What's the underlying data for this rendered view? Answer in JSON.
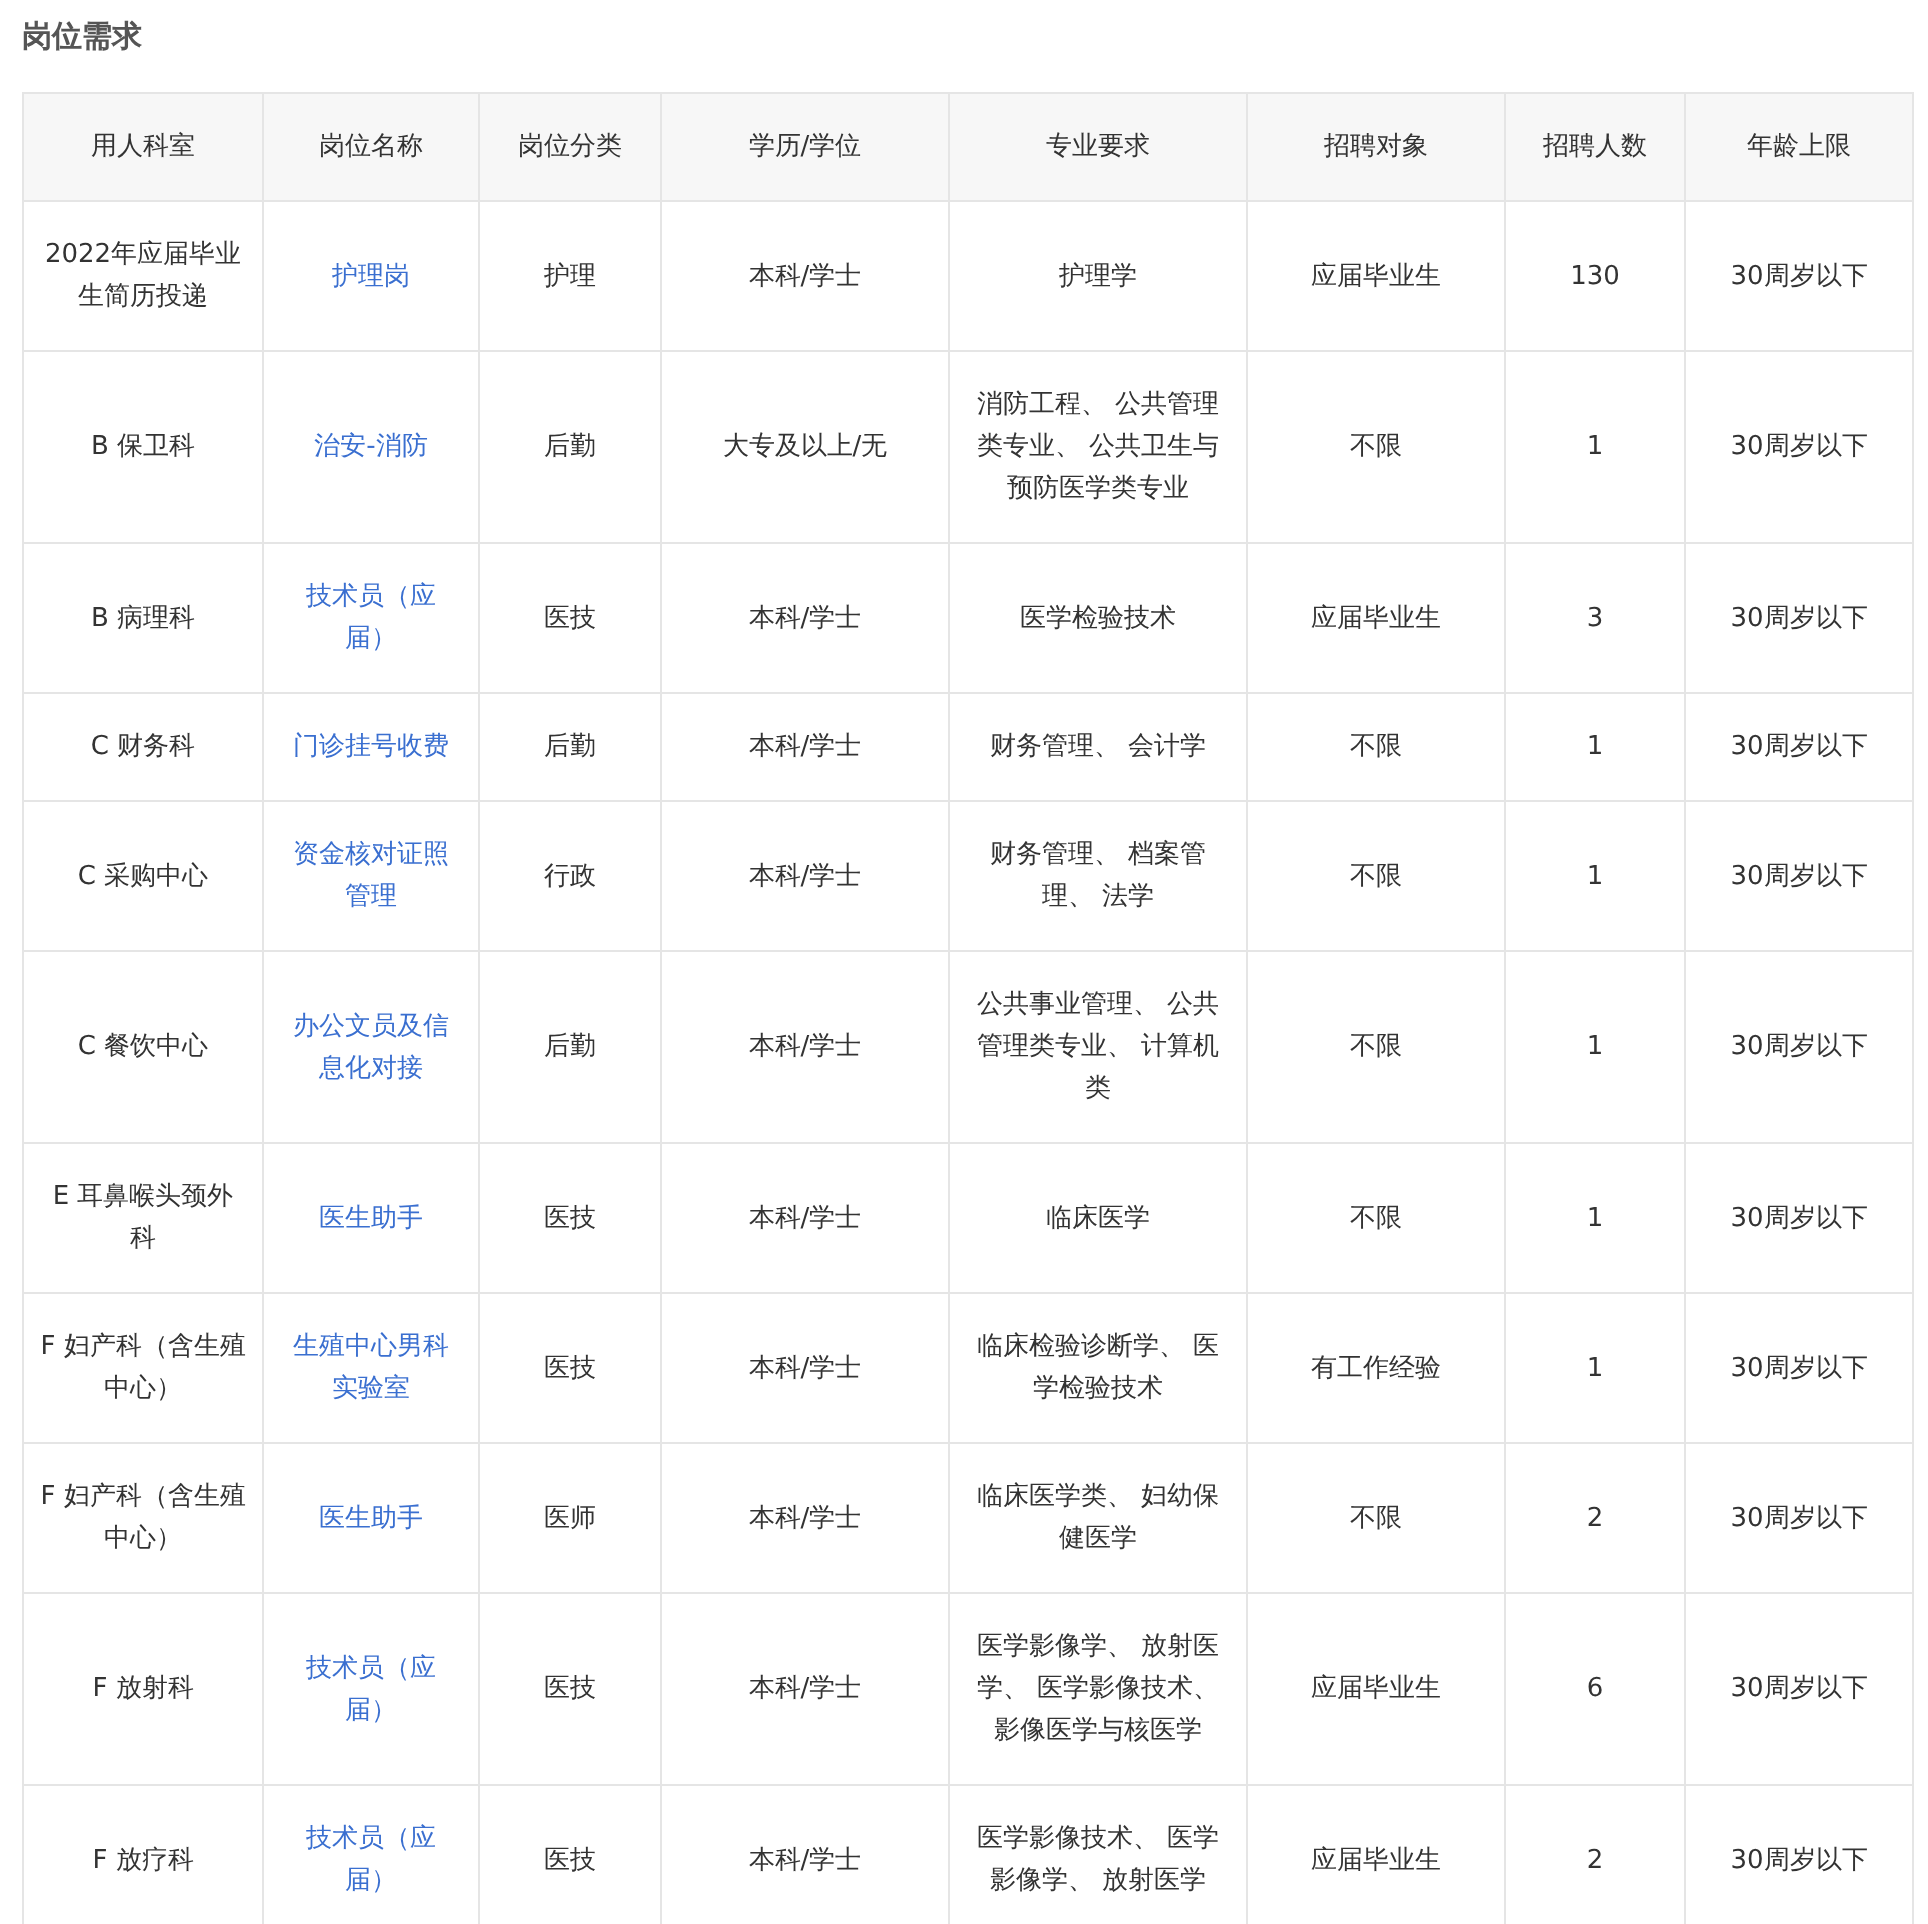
{
  "title": "岗位需求",
  "table": {
    "columns": [
      "用人科室",
      "岗位名称",
      "岗位分类",
      "学历/学位",
      "专业要求",
      "招聘对象",
      "招聘人数",
      "年龄上限"
    ],
    "rows": [
      [
        "2022年应届毕业生简历投递",
        "护理岗",
        "护理",
        "本科/学士",
        "护理学",
        "应届毕业生",
        "130",
        "30周岁以下"
      ],
      [
        "B 保卫科",
        "治安-消防",
        "后勤",
        "大专及以上/无",
        "消防工程、 公共管理类专业、 公共卫生与预防医学类专业",
        "不限",
        "1",
        "30周岁以下"
      ],
      [
        "B 病理科",
        "技术员（应届）",
        "医技",
        "本科/学士",
        "医学检验技术",
        "应届毕业生",
        "3",
        "30周岁以下"
      ],
      [
        "C 财务科",
        "门诊挂号收费",
        "后勤",
        "本科/学士",
        "财务管理、 会计学",
        "不限",
        "1",
        "30周岁以下"
      ],
      [
        "C 采购中心",
        "资金核对证照管理",
        "行政",
        "本科/学士",
        "财务管理、 档案管理、 法学",
        "不限",
        "1",
        "30周岁以下"
      ],
      [
        "C 餐饮中心",
        "办公文员及信息化对接",
        "后勤",
        "本科/学士",
        "公共事业管理、 公共管理类专业、 计算机类",
        "不限",
        "1",
        "30周岁以下"
      ],
      [
        "E 耳鼻喉头颈外科",
        "医生助手",
        "医技",
        "本科/学士",
        "临床医学",
        "不限",
        "1",
        "30周岁以下"
      ],
      [
        "F 妇产科（含生殖中心）",
        "生殖中心男科实验室",
        "医技",
        "本科/学士",
        "临床检验诊断学、 医学检验技术",
        "有工作经验",
        "1",
        "30周岁以下"
      ],
      [
        "F 妇产科（含生殖中心）",
        "医生助手",
        "医师",
        "本科/学士",
        "临床医学类、 妇幼保健医学",
        "不限",
        "2",
        "30周岁以下"
      ],
      [
        "F 放射科",
        "技术员（应届）",
        "医技",
        "本科/学士",
        "医学影像学、 放射医学、 医学影像技术、影像医学与核医学",
        "应届毕业生",
        "6",
        "30周岁以下"
      ],
      [
        "F 放疗科",
        "技术员（应届）",
        "医技",
        "本科/学士",
        "医学影像技术、 医学影像学、 放射医学",
        "应届毕业生",
        "2",
        "30周岁以下"
      ]
    ]
  }
}
